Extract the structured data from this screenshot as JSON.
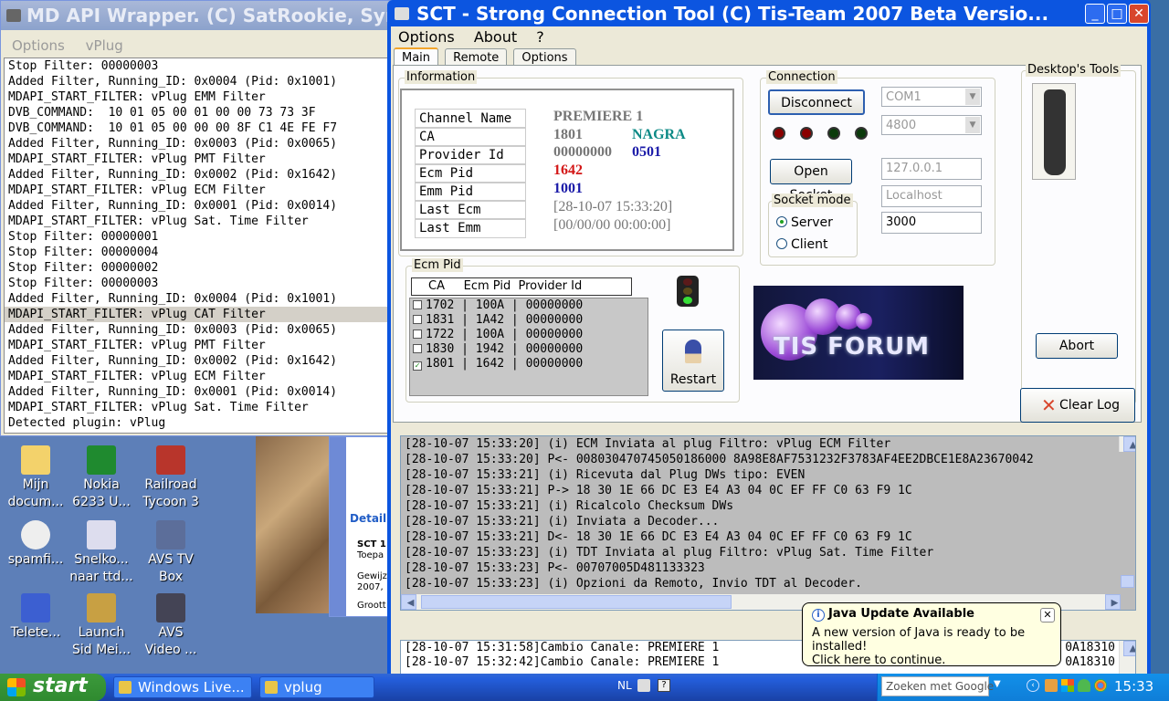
{
  "md_window": {
    "title": "MD API Wrapper. (C) SatRookie, Symb",
    "menu": [
      "Options",
      "vPlug"
    ],
    "log": [
      "Stop Filter: 00000003",
      "Added Filter, Running_ID: 0x0004 (Pid: 0x1001)",
      "MDAPI_START_FILTER: vPlug EMM Filter",
      "DVB_COMMAND:  10 01 05 00 01 00 00 73 73 3F",
      "DVB_COMMAND:  10 01 05 00 00 00 8F C1 4E FE F7",
      "Added Filter, Running_ID: 0x0003 (Pid: 0x0065)",
      "MDAPI_START_FILTER: vPlug PMT Filter",
      "Added Filter, Running_ID: 0x0002 (Pid: 0x1642)",
      "MDAPI_START_FILTER: vPlug ECM Filter",
      "Added Filter, Running_ID: 0x0001 (Pid: 0x0014)",
      "MDAPI_START_FILTER: vPlug Sat. Time Filter",
      "Stop Filter: 00000001",
      "Stop Filter: 00000004",
      "Stop Filter: 00000002",
      "Stop Filter: 00000003",
      "Added Filter, Running_ID: 0x0004 (Pid: 0x1001)",
      "MDAPI_START_FILTER: vPlug CAT Filter",
      "Added Filter, Running_ID: 0x0003 (Pid: 0x0065)",
      "MDAPI_START_FILTER: vPlug PMT Filter",
      "Added Filter, Running_ID: 0x0002 (Pid: 0x1642)",
      "MDAPI_START_FILTER: vPlug ECM Filter",
      "Added Filter, Running_ID: 0x0001 (Pid: 0x0014)",
      "MDAPI_START_FILTER: vPlug Sat. Time Filter",
      "Detected plugin: vPlug"
    ]
  },
  "sct": {
    "title": "SCT - Strong Connection Tool     (C) Tis-Team 2007     Beta  Versio...",
    "menu": [
      "Options",
      "About",
      "?"
    ],
    "tabs": [
      "Main",
      "Remote",
      "Options"
    ],
    "info": {
      "group_label": "Information",
      "labels": [
        "Channel Name",
        "CA",
        "Provider Id",
        "Ecm Pid",
        "Emm Pid",
        "Last Ecm",
        "Last Emm"
      ],
      "channel_name": "PREMIERE 1",
      "ca": "1801",
      "ca_name": "NAGRA",
      "provider_id_a": "00000000",
      "provider_id_b": "0501",
      "ecm_pid": "1642",
      "emm_pid": "1001",
      "last_ecm": "[28-10-07 15:33:20]",
      "last_emm": "[00/00/00 00:00:00]"
    },
    "ecm": {
      "group_label": "Ecm Pid",
      "header": "CA     Ecm Pid  Provider Id",
      "items": [
        {
          "text": "1702 | 100A | 00000000",
          "checked": false
        },
        {
          "text": "1831 | 1A42 | 00000000",
          "checked": false
        },
        {
          "text": "1722 | 100A | 00000000",
          "checked": false
        },
        {
          "text": "1830 | 1942 | 00000000",
          "checked": false
        },
        {
          "text": "1801 | 1642 | 00000000",
          "checked": true
        }
      ],
      "restart_label": "Restart"
    },
    "connection": {
      "group_label": "Connection",
      "disconnect_label": "Disconnect",
      "com_port": "COM1",
      "baud": "4800",
      "open_socket_label": "Open Socket",
      "ip": "127.0.0.1",
      "host": "Localhost",
      "port": "3000",
      "socket_mode_label": "Socket mode",
      "server_label": "Server",
      "client_label": "Client",
      "led_colors": [
        "#8b0000",
        "#8b0000",
        "#0b3b0b",
        "#0b3b0b"
      ]
    },
    "forum_label": "TIS FORUM",
    "desktop_tools": {
      "label": "Desktop's Tools",
      "abort_label": "Abort"
    },
    "clear_log_label": "Clear Log",
    "log": [
      "[28-10-07 15:33:20] (i) ECM Inviata al plug Filtro: vPlug ECM Filter",
      "[28-10-07 15:33:20] P<- 008030470745050186000 8A98E8AF7531232F3783AF4EE2DBCE1E8A23670042",
      "[28-10-07 15:33:21] (i) Ricevuta dal Plug DWs tipo: EVEN",
      "[28-10-07 15:33:21] P-> 18 30 1E 66 DC E3 E4 A3 04 0C EF FF C0 63 F9 1C",
      "[28-10-07 15:33:21] (i) Ricalcolo Checksum DWs",
      "[28-10-07 15:33:21] (i) Inviata a Decoder...",
      "[28-10-07 15:33:21] D<- 18 30 1E 66 DC E3 E4 A3 04 0C EF FF C0 63 F9 1C",
      "[28-10-07 15:33:23] (i) TDT Inviata al plug Filtro: vPlug Sat. Time Filter",
      "[28-10-07 15:33:23] P<- 00707005D481133323",
      "[28-10-07 15:33:23] (i) Opzioni da Remoto, Invio TDT al Decoder."
    ],
    "log2": [
      "[28-10-07 15:31:58]Cambio Canale: PREMIERE 1",
      "[28-10-07 15:32:42]Cambio Canale: PREMIERE 1"
    ],
    "log2_tail": [
      "0A18310",
      "0A18310"
    ]
  },
  "balloon": {
    "title": "Java Update Available",
    "line1": "A new version of Java is ready to be installed!",
    "line2": "Click here to continue."
  },
  "desktop_icons": [
    {
      "l1": "Mijn",
      "l2": "docum..."
    },
    {
      "l1": "Nokia",
      "l2": "6233 U..."
    },
    {
      "l1": "Railroad",
      "l2": "Tycoon 3"
    },
    {
      "l1": "spamfi...",
      "l2": ""
    },
    {
      "l1": "Snelko...",
      "l2": "naar ttd..."
    },
    {
      "l1": "AVS TV",
      "l2": "Box"
    },
    {
      "l1": "Telete...",
      "l2": ""
    },
    {
      "l1": "Launch",
      "l2": "Sid Mei..."
    },
    {
      "l1": "AVS",
      "l2": "Video ..."
    }
  ],
  "explorer_fragment": {
    "detail": "Detail",
    "sct": "SCT 1",
    "t1": "Toepa",
    "t2": "Gewijz",
    "t3": "2007,",
    "t4": "Groott"
  },
  "taskbar": {
    "start": "start",
    "tasks": [
      "Windows Live...",
      "vplug"
    ],
    "lang": "NL",
    "search_placeholder": "Zoeken met Google",
    "clock": "15:33"
  }
}
